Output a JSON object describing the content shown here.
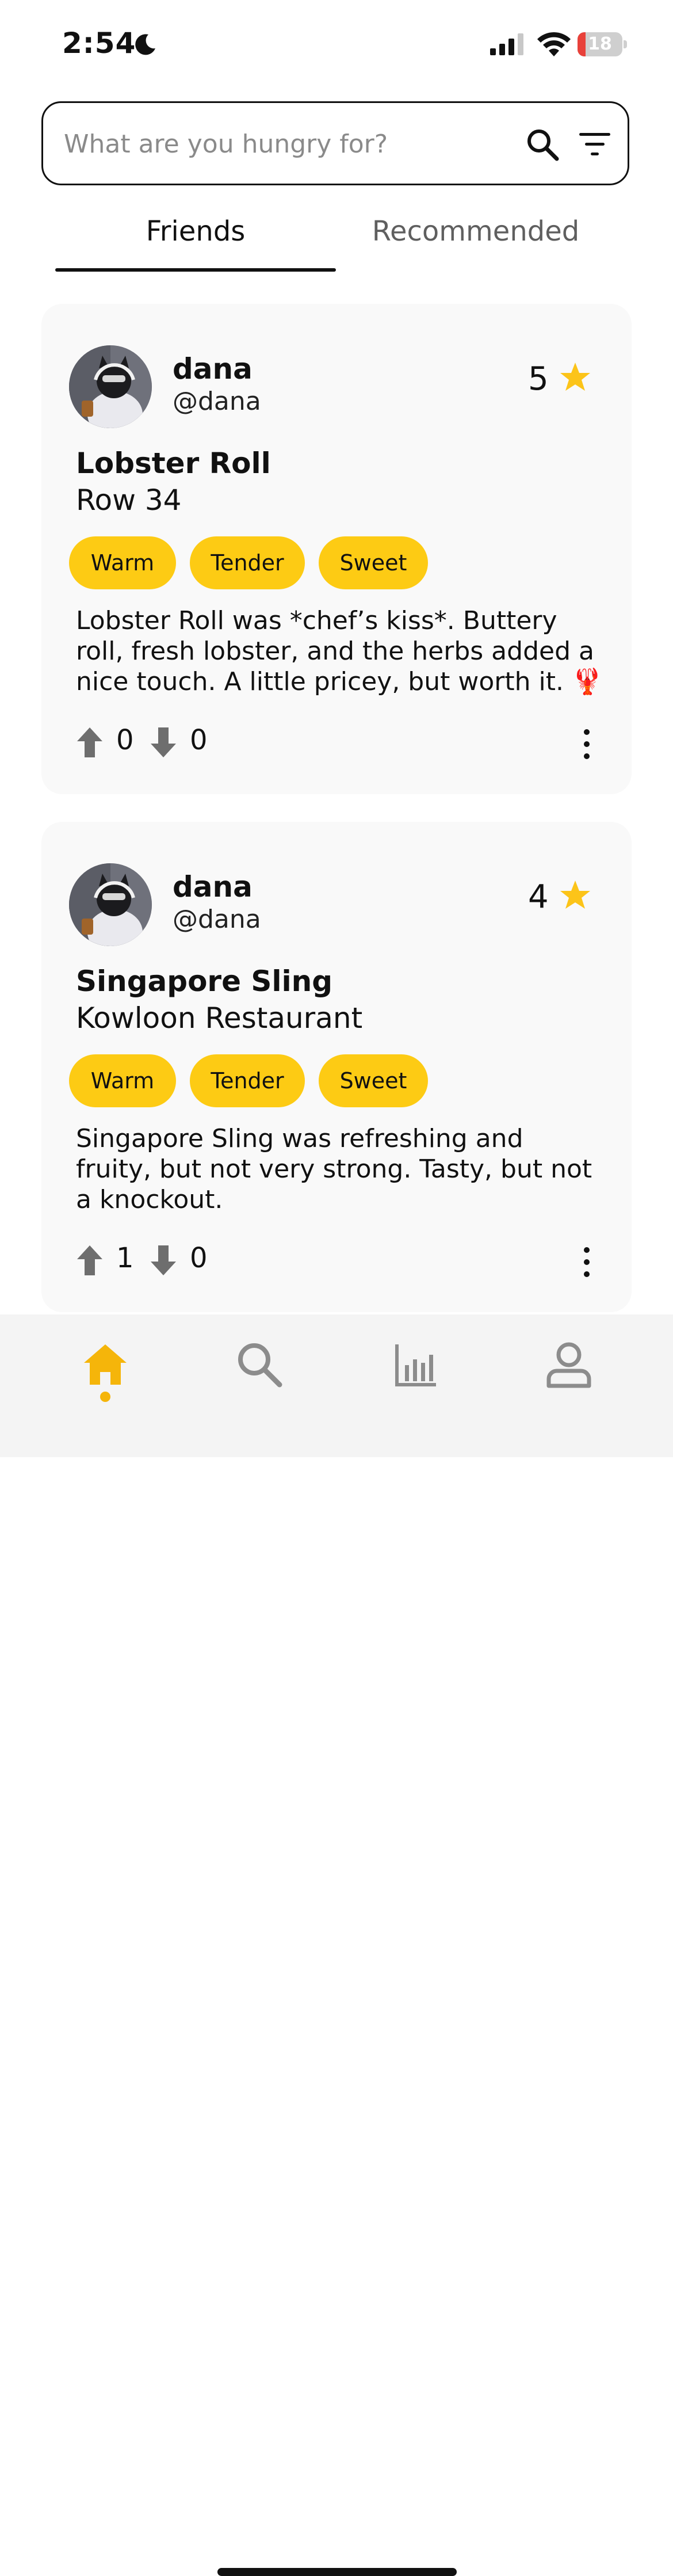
{
  "status_bar": {
    "time": "2:54",
    "battery_level": "18",
    "battery_fraction": 0.18
  },
  "search": {
    "placeholder": "What are you hungry for?",
    "value": ""
  },
  "tabs": [
    {
      "label": "Friends",
      "active": true
    },
    {
      "label": "Recommended",
      "active": false
    }
  ],
  "reviews": [
    {
      "user_name": "dana",
      "handle": "@dana",
      "rating": "5",
      "dish": "Lobster Roll",
      "restaurant": "Row 34",
      "tags": [
        "Warm",
        "Tender",
        "Sweet"
      ],
      "text": "Lobster Roll was *chef’s kiss*. Buttery roll, fresh lobster, and the herbs added a nice touch. A little pricey, but worth it. 🦞",
      "upvotes": "0",
      "downvotes": "0"
    },
    {
      "user_name": "dana",
      "handle": "@dana",
      "rating": "4",
      "dish": "Singapore Sling",
      "restaurant": "Kowloon Restaurant",
      "tags": [
        "Warm",
        "Tender",
        "Sweet"
      ],
      "text": "Singapore Sling was refreshing and fruity, but not very strong. Tasty, but not a knockout.",
      "upvotes": "1",
      "downvotes": "0"
    }
  ],
  "nav": {
    "items": [
      "home-icon",
      "search-icon",
      "stats-icon",
      "profile-icon"
    ],
    "active": "home-icon"
  },
  "colors": {
    "accent": "#fdcb14",
    "star": "#fcc419",
    "nav_active": "#f5b50a",
    "nav_inactive": "#8c8c8c",
    "vote_icon": "#6e6e6e"
  }
}
